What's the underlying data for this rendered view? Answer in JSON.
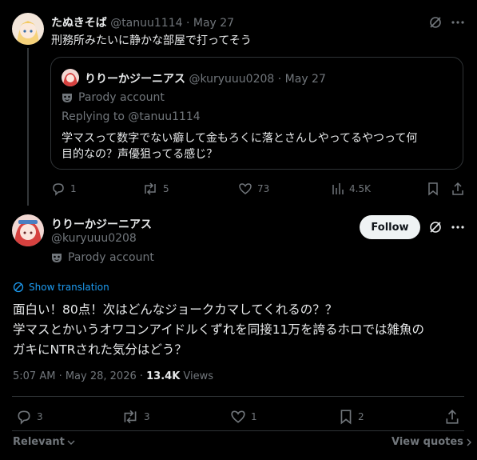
{
  "parent": {
    "name": "たぬきそば",
    "handle": "@tanuu1114",
    "date": "May 27",
    "text": "刑務所みたいに静かな部屋で打ってそう",
    "stats": {
      "replies": "1",
      "reposts": "5",
      "likes": "73",
      "views": "4.5K"
    }
  },
  "quoted": {
    "name": "りりーかジーニアス",
    "handle": "@kuryuuu0208",
    "date": "May 27",
    "parody": "Parody account",
    "replying_label": "Replying to",
    "replying_to": "@tanuu1114",
    "text_line1": "学マスって数字でない癖して金もろくに落とさんしやってるやつって何",
    "text_line2": "目的なの？声優狙ってる感じ？"
  },
  "main": {
    "name": "りりーかジーニアス",
    "handle": "@kuryuuu0208",
    "parody": "Parody account",
    "follow_label": "Follow",
    "show_translation": "Show translation",
    "text_line1": "面白い！80点！次はどんなジョークカマしてくれるの？？",
    "text_line2": "学マスとかいうオワコンアイドルくずれを同接11万を誇るホロでは雑魚の",
    "text_line3": "ガキにNTRされた気分はどう？",
    "time": "5:07 AM · May 28, 2026 · ",
    "views_count": "13.4K",
    "views_label": " Views",
    "stats": {
      "replies": "3",
      "reposts": "3",
      "likes": "1",
      "bookmarks": "2"
    }
  },
  "footer": {
    "relevant_label": "Relevant",
    "view_quotes_label": "View quotes"
  }
}
